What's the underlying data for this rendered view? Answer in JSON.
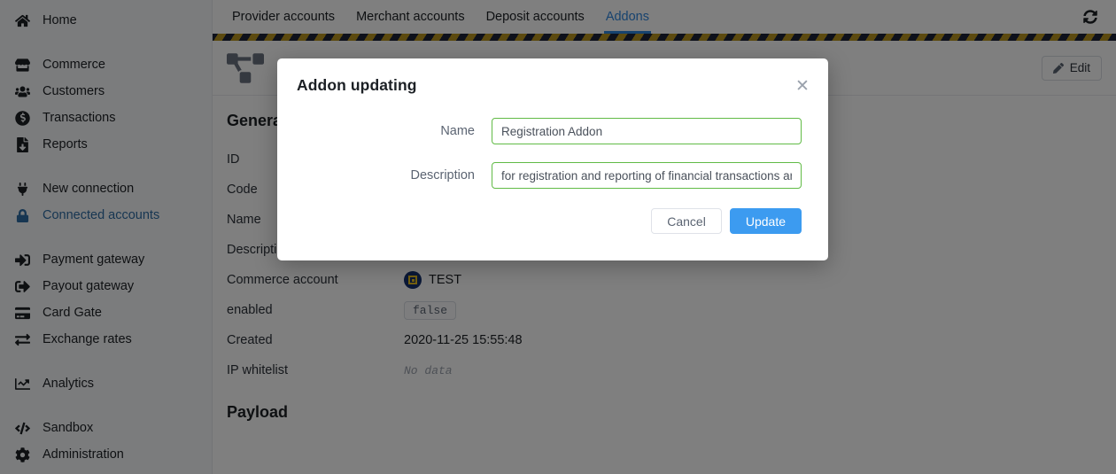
{
  "sidebar": {
    "groups": [
      {
        "items": [
          {
            "label": "Home",
            "icon": "home-icon",
            "active": false
          }
        ]
      },
      {
        "items": [
          {
            "label": "Commerce",
            "icon": "store-icon",
            "active": false
          },
          {
            "label": "Customers",
            "icon": "users-icon",
            "active": false
          },
          {
            "label": "Transactions",
            "icon": "dollar-circle-icon",
            "active": false
          },
          {
            "label": "Reports",
            "icon": "file-download-icon",
            "active": false
          }
        ]
      },
      {
        "items": [
          {
            "label": "New connection",
            "icon": "plug-icon",
            "active": false
          },
          {
            "label": "Connected accounts",
            "icon": "lock-icon",
            "active": true
          }
        ]
      },
      {
        "items": [
          {
            "label": "Payment gateway",
            "icon": "sign-in-icon",
            "active": false
          },
          {
            "label": "Payout gateway",
            "icon": "sign-out-icon",
            "active": false
          },
          {
            "label": "Card Gate",
            "icon": "credit-card-icon",
            "active": false
          },
          {
            "label": "Exchange rates",
            "icon": "exchange-icon",
            "active": false
          }
        ]
      },
      {
        "items": [
          {
            "label": "Analytics",
            "icon": "chart-line-icon",
            "active": false
          }
        ]
      },
      {
        "items": [
          {
            "label": "Sandbox",
            "icon": "code-icon",
            "active": false
          },
          {
            "label": "Administration",
            "icon": "gear-icon",
            "active": false
          }
        ]
      }
    ]
  },
  "tabs": [
    {
      "label": "Provider accounts",
      "active": false
    },
    {
      "label": "Merchant accounts",
      "active": false
    },
    {
      "label": "Deposit accounts",
      "active": false
    },
    {
      "label": "Addons",
      "active": true
    }
  ],
  "toolbar": {
    "refresh_icon": "refresh-icon",
    "edit_label": "Edit",
    "edit_icon": "pencil-icon",
    "panel_icon": "project-diagram-icon"
  },
  "details": {
    "section_title": "General",
    "rows": [
      {
        "key": "ID",
        "value": "",
        "type": "text"
      },
      {
        "key": "Code",
        "value": "",
        "type": "text"
      },
      {
        "key": "Name",
        "value": "",
        "type": "text"
      },
      {
        "key": "Description",
        "value": "",
        "type": "text"
      },
      {
        "key": "Commerce account",
        "value": "TEST",
        "type": "account"
      },
      {
        "key": "enabled",
        "value": "false",
        "type": "chip"
      },
      {
        "key": "Created",
        "value": "2020-11-25 15:55:48",
        "type": "text"
      },
      {
        "key": "IP whitelist",
        "value": "No data",
        "type": "nodata"
      }
    ],
    "payload_title": "Payload"
  },
  "modal": {
    "title": "Addon updating",
    "close_icon": "close-icon",
    "fields": [
      {
        "label": "Name",
        "value": "Registration Addon",
        "placeholder": "Name"
      },
      {
        "label": "Description",
        "value": "for registration and reporting of financial transactions and s",
        "placeholder": "Description"
      }
    ],
    "cancel_label": "Cancel",
    "update_label": "Update"
  },
  "colors": {
    "accent_blue": "#3c9bf0",
    "active_nav": "#2e6da4",
    "tab_active": "#2e86de",
    "input_border_green": "#61bb46",
    "hazard_dark": "#1d2236",
    "hazard_yellow": "#b8941f",
    "account_badge": "#14306e",
    "account_badge_inner": "#e8c020"
  }
}
